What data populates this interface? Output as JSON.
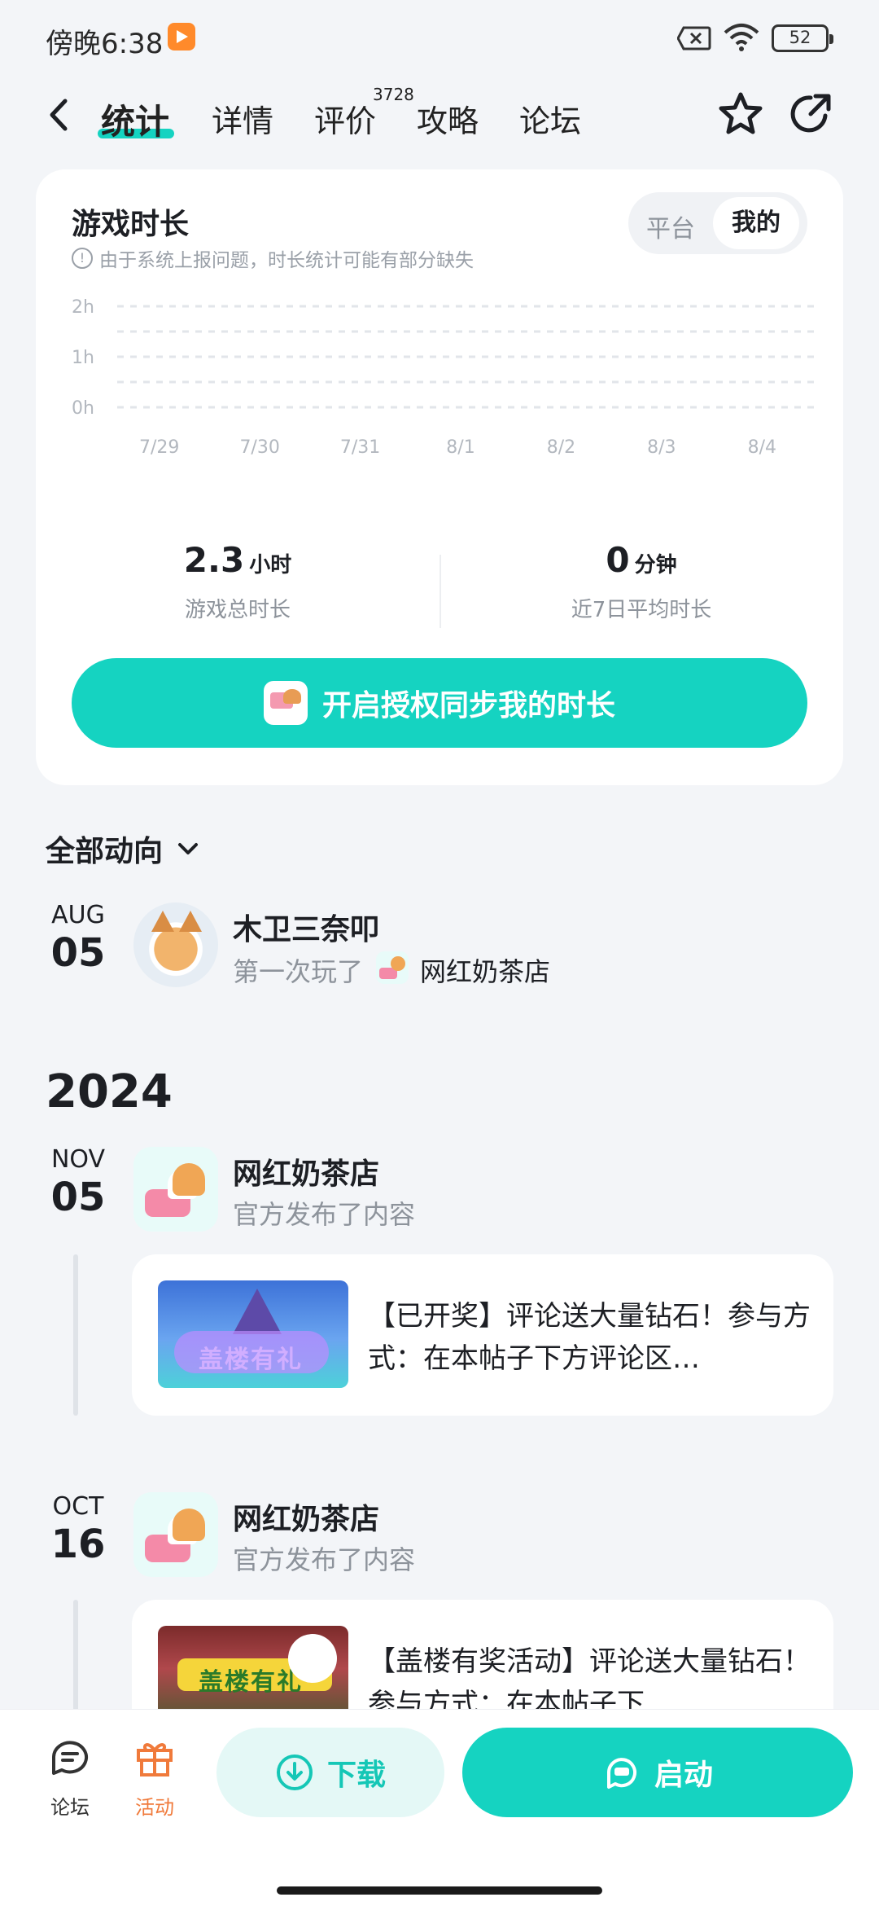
{
  "status_bar": {
    "time": "傍晚6:38",
    "battery": "52"
  },
  "nav": {
    "tabs": [
      {
        "label": "统计",
        "active": true
      },
      {
        "label": "详情"
      },
      {
        "label": "评价",
        "badge": "3728"
      },
      {
        "label": "攻略"
      },
      {
        "label": "论坛"
      }
    ]
  },
  "playtime": {
    "title": "游戏时长",
    "note": "由于系统上报问题，时长统计可能有部分缺失",
    "toggle": {
      "option_a": "平台",
      "option_b": "我的",
      "selected": "我的"
    },
    "stats": [
      {
        "value": "2.3",
        "unit": "小时",
        "label": "游戏总时长"
      },
      {
        "value": "0",
        "unit": "分钟",
        "label": "近7日平均时长"
      }
    ],
    "cta": "开启授权同步我的时长"
  },
  "chart_data": {
    "type": "bar",
    "categories": [
      "7/29",
      "7/30",
      "7/31",
      "8/1",
      "8/2",
      "8/3",
      "8/4"
    ],
    "values": [
      0,
      0,
      0,
      0,
      0,
      0,
      0
    ],
    "y_ticks": [
      "0h",
      "1h",
      "2h"
    ],
    "ylim": [
      0,
      2
    ],
    "grid": true
  },
  "feed": {
    "filter_label": "全部动向",
    "items": [
      {
        "month": "AUG",
        "day": "05",
        "name": "木卫三奈叩",
        "action": "第一次玩了",
        "game": "网红奶茶店"
      }
    ],
    "year_header": "2024",
    "posts": [
      {
        "month": "NOV",
        "day": "05",
        "name": "网红奶茶店",
        "action": "官方发布了内容",
        "thumb_text": "盖楼有礼",
        "post_text": "【已开奖】评论送大量钻石！参与方式：在本帖子下方评论区…"
      },
      {
        "month": "OCT",
        "day": "16",
        "name": "网红奶茶店",
        "action": "官方发布了内容",
        "thumb_text": "盖楼有礼",
        "post_text": "【盖楼有奖活动】评论送大量钻石！参与方式：在本帖子下"
      }
    ]
  },
  "bottom_bar": {
    "forum_label": "论坛",
    "activity_label": "活动",
    "download_label": "下载",
    "launch_label": "启动",
    "accent_color": "#15d3c1",
    "activity_color": "#f07a3b"
  }
}
